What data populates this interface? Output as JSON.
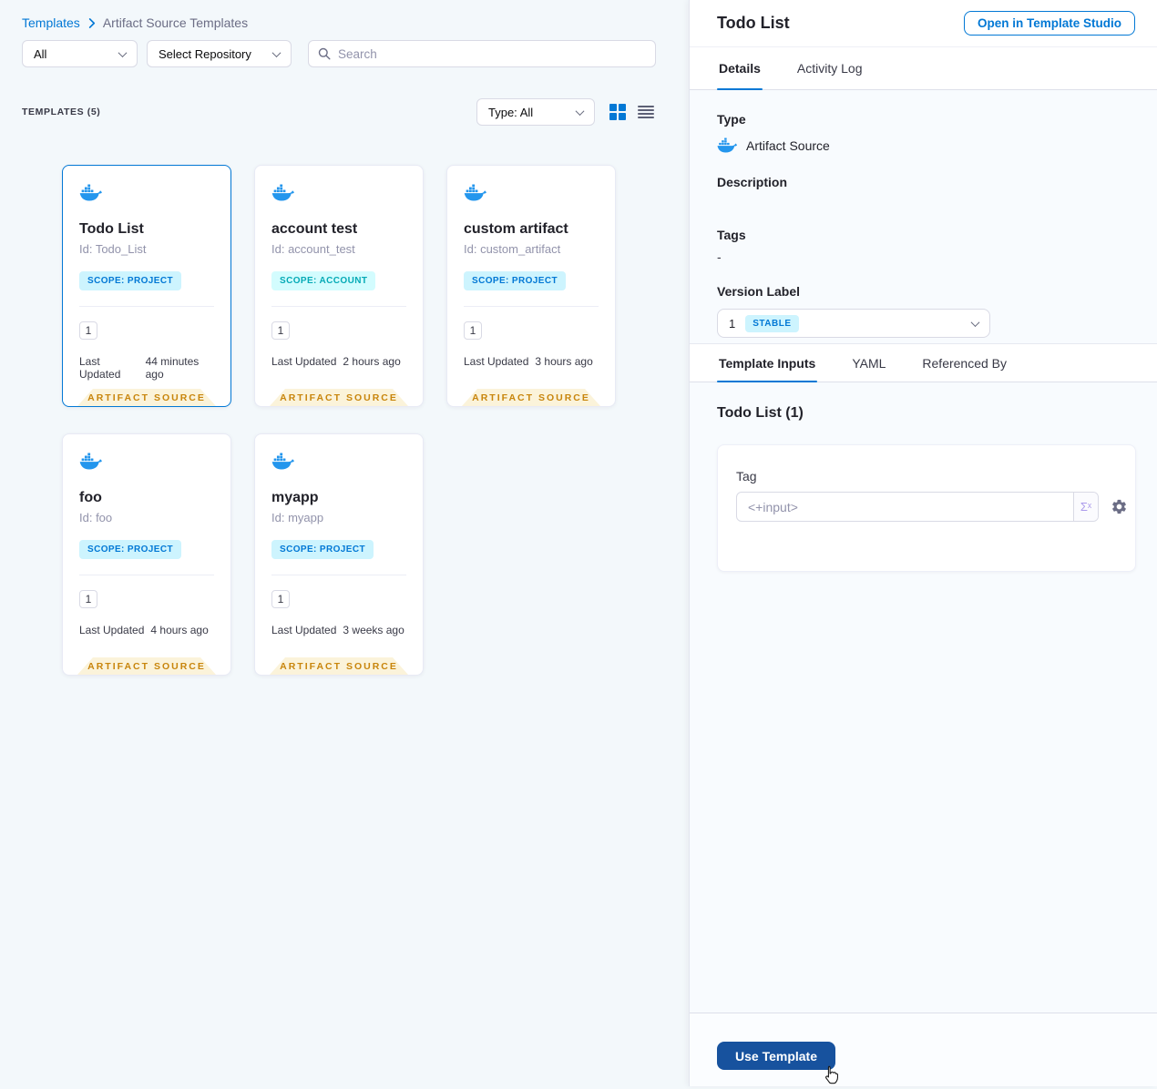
{
  "breadcrumb": {
    "root": "Templates",
    "current": "Artifact Source Templates"
  },
  "filters": {
    "scope": "All",
    "repository": "Select Repository",
    "search_placeholder": "Search"
  },
  "list_header": {
    "count": "TEMPLATES (5)",
    "type_filter": "Type: All"
  },
  "labels": {
    "last_updated": "Last Updated",
    "ribbon": "ARTIFACT SOURCE"
  },
  "cards": [
    {
      "title": "Todo List",
      "id": "Id: Todo_List",
      "scope": "SCOPE: PROJECT",
      "versions": "1",
      "updated": "44 minutes ago"
    },
    {
      "title": "account test",
      "id": "Id: account_test",
      "scope": "SCOPE: ACCOUNT",
      "versions": "1",
      "updated": "2 hours ago"
    },
    {
      "title": "custom artifact",
      "id": "Id: custom_artifact",
      "scope": "SCOPE: PROJECT",
      "versions": "1",
      "updated": "3 hours ago"
    },
    {
      "title": "foo",
      "id": "Id: foo",
      "scope": "SCOPE: PROJECT",
      "versions": "1",
      "updated": "4 hours ago"
    },
    {
      "title": "myapp",
      "id": "Id: myapp",
      "scope": "SCOPE: PROJECT",
      "versions": "1",
      "updated": "3 weeks ago"
    }
  ],
  "drawer": {
    "title": "Todo List",
    "open_button": "Open in Template Studio",
    "tabs": {
      "details": "Details",
      "activity_log": "Activity Log"
    },
    "details": {
      "type_label": "Type",
      "type_value": "Artifact Source",
      "description_label": "Description",
      "tags_label": "Tags",
      "tags_value": "-",
      "version_label": "Version Label",
      "version_value": "1",
      "version_badge": "STABLE"
    },
    "inner_tabs": {
      "template_inputs": "Template Inputs",
      "yaml": "YAML",
      "referenced_by": "Referenced By"
    },
    "inputs": {
      "section_title": "Todo List (1)",
      "tag_label": "Tag",
      "tag_value": "<+input>",
      "expression_icon": "Σˣ"
    },
    "footer": {
      "use_template": "Use Template"
    }
  },
  "colors": {
    "accent": "#0278D5",
    "docker_blue": "#2496ED",
    "ribbon_bg": "#FBF3DA",
    "ribbon_text": "#C8850C",
    "badge_project_bg": "#CDF4FE",
    "badge_account_bg": "#D3FCFE",
    "badge_account_text": "#05AAB6",
    "use_template_bg": "#17529E"
  }
}
